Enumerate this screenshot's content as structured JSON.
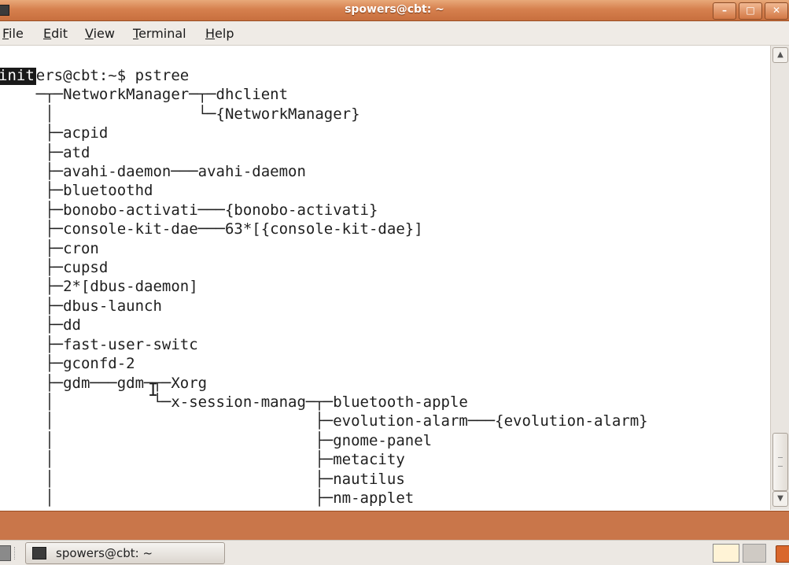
{
  "window": {
    "title": "spowers@cbt: ~",
    "buttons": {
      "minimize": "–",
      "maximize": "□",
      "close": "✕"
    }
  },
  "menu": [
    {
      "pre": "",
      "key": "F",
      "post": "ile"
    },
    {
      "pre": "",
      "key": "E",
      "post": "dit"
    },
    {
      "pre": "",
      "key": "V",
      "post": "iew"
    },
    {
      "pre": "",
      "key": "T",
      "post": "erminal"
    },
    {
      "pre": "",
      "key": "H",
      "post": "elp"
    }
  ],
  "terminal": {
    "highlight": "init",
    "lines": [
      "spowers@cbt:~$ pstree",
      "    ─┬─NetworkManager─┬─dhclient",
      "     │                └─{NetworkManager}",
      "     ├─acpid",
      "     ├─atd",
      "     ├─avahi-daemon───avahi-daemon",
      "     ├─bluetoothd",
      "     ├─bonobo-activati───{bonobo-activati}",
      "     ├─console-kit-dae───63*[{console-kit-dae}]",
      "     ├─cron",
      "     ├─cupsd",
      "     ├─2*[dbus-daemon]",
      "     ├─dbus-launch",
      "     ├─dd",
      "     ├─fast-user-switc",
      "     ├─gconfd-2",
      "     ├─gdm───gdm─┬─Xorg",
      "     │           └─x-session-manag─┬─bluetooth-apple",
      "     │                             ├─evolution-alarm───{evolution-alarm}",
      "     │                             ├─gnome-panel",
      "     │                             ├─metacity",
      "     │                             ├─nautilus",
      "     │                             ├─nm-applet"
    ]
  },
  "scrollbar": {
    "up_arrow": "▲",
    "down_arrow": "▼"
  },
  "taskbar": {
    "task_label": "spowers@cbt: ~"
  }
}
